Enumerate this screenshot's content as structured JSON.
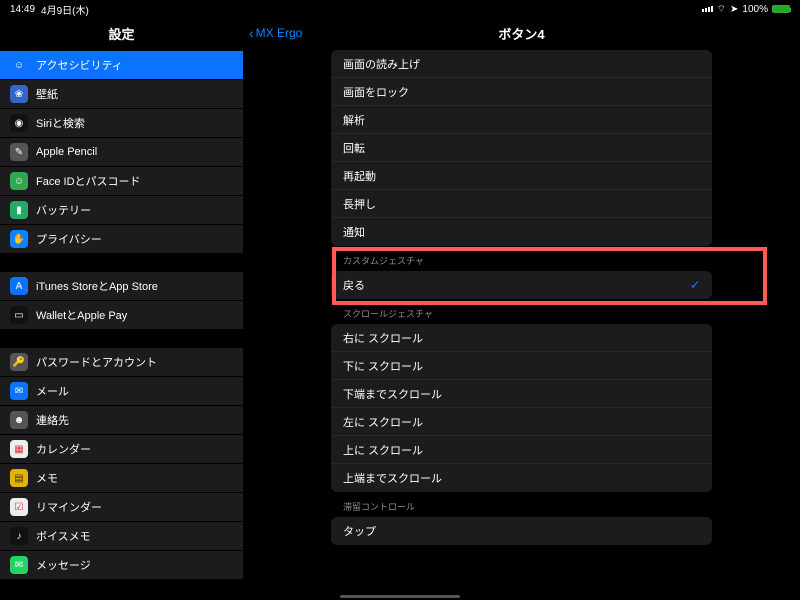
{
  "status": {
    "time": "14:49",
    "date": "4月9日(木)",
    "battery": "100%"
  },
  "sidebar": {
    "title": "設定",
    "g1": [
      {
        "label": "アクセシビリティ",
        "glyph": "☺",
        "cls": "bg-blue",
        "selected": true
      },
      {
        "label": "壁紙",
        "glyph": "❀",
        "cls": "bg-cyan"
      },
      {
        "label": "Siriと検索",
        "glyph": "◉",
        "cls": "bg-black"
      },
      {
        "label": "Apple Pencil",
        "glyph": "✎",
        "cls": "bg-gray"
      },
      {
        "label": "Face IDとパスコード",
        "glyph": "☺",
        "cls": "bg-green"
      },
      {
        "label": "バッテリー",
        "glyph": "▮",
        "cls": "bg-darkgreen"
      },
      {
        "label": "プライバシー",
        "glyph": "✋",
        "cls": "bg-palm"
      }
    ],
    "g2": [
      {
        "label": "iTunes StoreとApp Store",
        "glyph": "A",
        "cls": "bg-blue"
      },
      {
        "label": "WalletとApple Pay",
        "glyph": "▭",
        "cls": "bg-black"
      }
    ],
    "g3": [
      {
        "label": "パスワードとアカウント",
        "glyph": "🔑",
        "cls": "bg-gray"
      },
      {
        "label": "メール",
        "glyph": "✉",
        "cls": "bg-blue"
      },
      {
        "label": "連絡先",
        "glyph": "☻",
        "cls": "bg-gray"
      },
      {
        "label": "カレンダー",
        "glyph": "▦",
        "cls": "bg-white"
      },
      {
        "label": "メモ",
        "glyph": "▤",
        "cls": "bg-yellow"
      },
      {
        "label": "リマインダー",
        "glyph": "☑",
        "cls": "bg-white"
      },
      {
        "label": "ボイスメモ",
        "glyph": "♪",
        "cls": "bg-black"
      },
      {
        "label": "メッセージ",
        "glyph": "✉",
        "cls": "bg-msg"
      }
    ]
  },
  "detail": {
    "back": "MX Ergo",
    "title": "ボタン4",
    "sec0": [
      "画面の読み上げ",
      "画面をロック",
      "解析",
      "回転",
      "再起動",
      "長押し",
      "通知"
    ],
    "sec1_header": "カスタムジェスチャ",
    "sec1": [
      {
        "label": "戻る",
        "checked": true
      }
    ],
    "sec2_header": "スクロールジェスチャ",
    "sec2": [
      "右に スクロール",
      "下に スクロール",
      "下端までスクロール",
      "左に スクロール",
      "上に スクロール",
      "上端までスクロール"
    ],
    "sec3_header": "滞留コントロール",
    "sec3": [
      "タップ"
    ]
  }
}
